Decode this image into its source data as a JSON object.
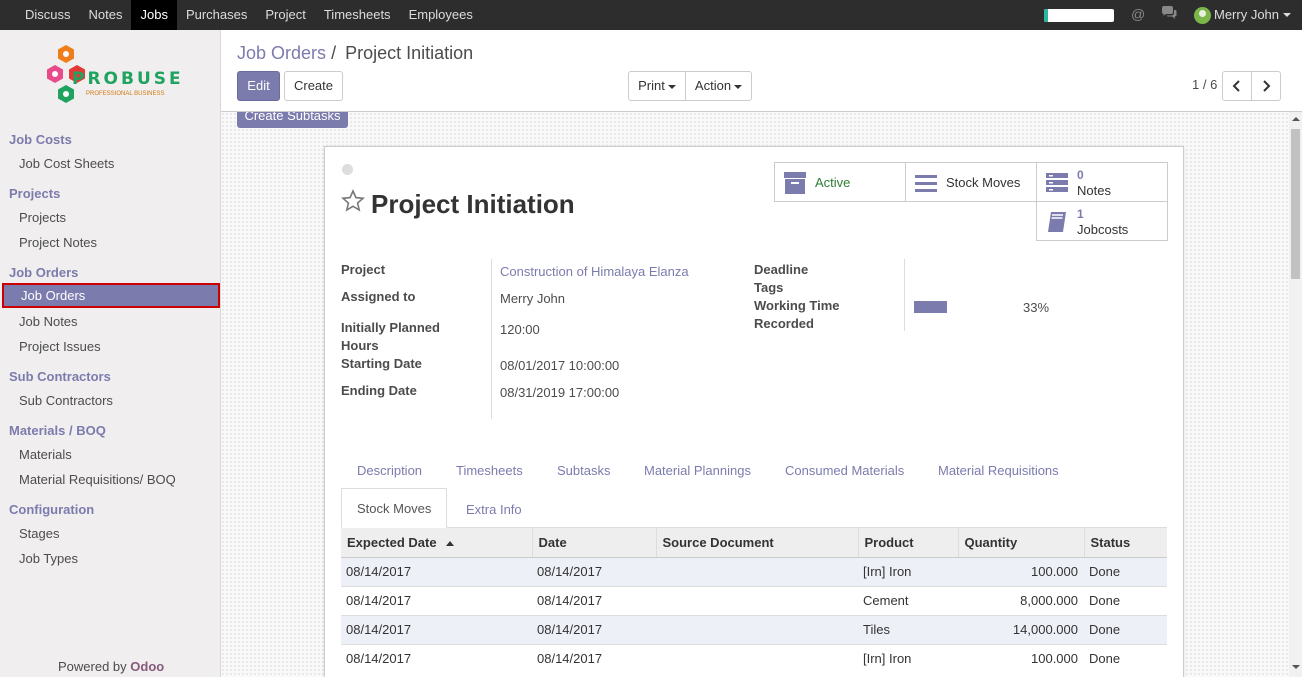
{
  "topbar": {
    "menu": [
      "Discuss",
      "Notes",
      "Jobs",
      "Purchases",
      "Project",
      "Timesheets",
      "Employees"
    ],
    "active_menu": "Jobs",
    "user_name": "Merry John",
    "progress_fraction": 0.05
  },
  "sidebar": {
    "logo_text": "PROBUSE",
    "logo_sub": "PROFESSIONAL BUSINESS",
    "sections": [
      {
        "title": "Job Costs",
        "items": [
          "Job Cost Sheets"
        ]
      },
      {
        "title": "Projects",
        "items": [
          "Projects",
          "Project Notes"
        ]
      },
      {
        "title": "Job Orders",
        "items": [
          "Job Orders",
          "Job Notes",
          "Project Issues"
        ]
      },
      {
        "title": "Sub Contractors",
        "items": [
          "Sub Contractors"
        ]
      },
      {
        "title": "Materials / BOQ",
        "items": [
          "Materials",
          "Material Requisitions/ BOQ"
        ]
      },
      {
        "title": "Configuration",
        "items": [
          "Stages",
          "Job Types"
        ]
      }
    ],
    "active_item": "Job Orders",
    "powered_prefix": "Powered by ",
    "powered_brand": "Odoo"
  },
  "control_panel": {
    "breadcrumb_parent": "Job Orders",
    "breadcrumb_sep": "/",
    "breadcrumb_current": "Project Initiation",
    "edit_label": "Edit",
    "create_label": "Create",
    "print_label": "Print",
    "action_label": "Action",
    "pager": "1 / 6"
  },
  "form": {
    "create_subtasks_label": "Create Subtasks",
    "title": "Project Initiation",
    "smart_buttons": {
      "active_label": "Active",
      "stock_moves_label": "Stock Moves",
      "notes_count": "0",
      "notes_label": "Notes",
      "jobcosts_count": "1",
      "jobcosts_label": "Jobcosts"
    },
    "fields_left": {
      "project_label": "Project",
      "project_value": "Construction of Himalaya Elanza",
      "assigned_label": "Assigned to",
      "assigned_value": "Merry John",
      "planned_label_1": "Initially Planned",
      "planned_label_2": "Hours",
      "planned_value": "120:00",
      "start_label": "Starting Date",
      "start_value": "08/01/2017 10:00:00",
      "end_label": "Ending Date",
      "end_value": "08/31/2019 17:00:00"
    },
    "fields_right": {
      "deadline_label": "Deadline",
      "tags_label": "Tags",
      "working_label_1": "Working Time",
      "working_label_2": "Recorded",
      "working_percent": "33%",
      "working_fraction": 0.33
    },
    "tabs_row1": [
      "Description",
      "Timesheets",
      "Subtasks",
      "Material Plannings",
      "Consumed Materials",
      "Material Requisitions"
    ],
    "tabs_row2": [
      "Stock Moves",
      "Extra Info"
    ],
    "active_tab": "Stock Moves",
    "table": {
      "columns": [
        "Expected Date",
        "Date",
        "Source Document",
        "Product",
        "Quantity",
        "Status"
      ],
      "rows": [
        [
          "08/14/2017",
          "08/14/2017",
          "",
          "[Irn] Iron",
          "100.000",
          "Done"
        ],
        [
          "08/14/2017",
          "08/14/2017",
          "",
          "Cement",
          "8,000.000",
          "Done"
        ],
        [
          "08/14/2017",
          "08/14/2017",
          "",
          "Tiles",
          "14,000.000",
          "Done"
        ],
        [
          "08/14/2017",
          "08/14/2017",
          "",
          "[Irn] Iron",
          "100.000",
          "Done"
        ]
      ]
    }
  },
  "colors": {
    "accent": "#7c7bad",
    "active_border": "#cc0000",
    "active_text": "#2e7d32"
  }
}
